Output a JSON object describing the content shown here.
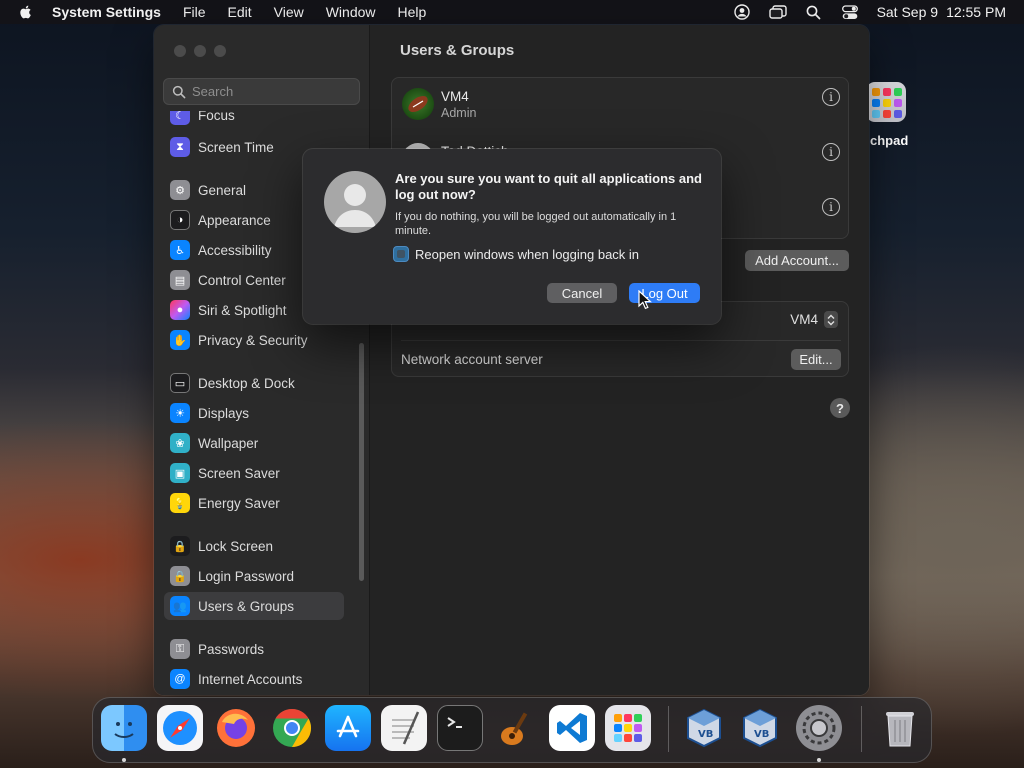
{
  "menubar": {
    "app_name": "System Settings",
    "items": [
      "File",
      "Edit",
      "View",
      "Window",
      "Help"
    ],
    "date": "Sat Sep 9",
    "time": "12:55 PM",
    "status_icons": [
      "user-icon",
      "window-icon",
      "search-icon",
      "control-center-icon"
    ]
  },
  "desktop": {
    "icon_label": "chpad"
  },
  "sidebar": {
    "search_placeholder": "Search",
    "items": [
      {
        "label": "Focus",
        "icon": "moon-icon",
        "color": "#5e5ce6"
      },
      {
        "label": "Screen Time",
        "icon": "hourglass-icon",
        "color": "#5e5ce6"
      },
      {
        "label": "General",
        "icon": "gear-icon",
        "color": "#8e8e93"
      },
      {
        "label": "Appearance",
        "icon": "appearance-icon",
        "color": "#1c1c1e"
      },
      {
        "label": "Accessibility",
        "icon": "accessibility-icon",
        "color": "#0a84ff"
      },
      {
        "label": "Control Center",
        "icon": "control-center-icon",
        "color": "#8e8e93"
      },
      {
        "label": "Siri & Spotlight",
        "icon": "siri-icon",
        "color": "#bf5af2"
      },
      {
        "label": "Privacy & Security",
        "icon": "hand-icon",
        "color": "#0a84ff"
      },
      {
        "label": "Desktop & Dock",
        "icon": "dock-icon",
        "color": "#1c1c1e"
      },
      {
        "label": "Displays",
        "icon": "displays-icon",
        "color": "#0a84ff"
      },
      {
        "label": "Wallpaper",
        "icon": "wallpaper-icon",
        "color": "#30b0c7"
      },
      {
        "label": "Screen Saver",
        "icon": "screen-saver-icon",
        "color": "#30b0c7"
      },
      {
        "label": "Energy Saver",
        "icon": "battery-icon",
        "color": "#ffd60a"
      },
      {
        "label": "Lock Screen",
        "icon": "lock-icon",
        "color": "#1c1c1e"
      },
      {
        "label": "Login Password",
        "icon": "lock-icon",
        "color": "#8e8e93"
      },
      {
        "label": "Users & Groups",
        "icon": "users-icon",
        "color": "#0a84ff"
      },
      {
        "label": "Passwords",
        "icon": "key-icon",
        "color": "#8e8e93"
      },
      {
        "label": "Internet Accounts",
        "icon": "at-icon",
        "color": "#0a84ff"
      }
    ],
    "selected": "Users & Groups"
  },
  "content": {
    "title": "Users & Groups",
    "users": [
      {
        "name": "VM4",
        "role": "Admin"
      },
      {
        "name": "Ted Dattich",
        "role": ""
      },
      {
        "name": "",
        "role": ""
      }
    ],
    "add_account_label": "Add Account...",
    "auto_login_value": "VM4",
    "network_server_label": "Network account server",
    "edit_label": "Edit...",
    "help_label": "?"
  },
  "dialog": {
    "title": "Are you sure you want to quit all applications and log out now?",
    "message": "If you do nothing, you will be logged out automatically in 1 minute.",
    "checkbox_label": "Reopen windows when logging back in",
    "checkbox_checked": true,
    "cancel_label": "Cancel",
    "logout_label": "Log Out"
  },
  "dock": {
    "apps": [
      "Finder",
      "Safari",
      "Firefox",
      "Chrome",
      "App Store",
      "TextEdit",
      "Terminal",
      "GarageBand",
      "Visual Studio Code",
      "Launchpad",
      "VirtualBox",
      "VirtualBox",
      "System Settings",
      "Trash"
    ]
  },
  "colors": {
    "accent": "#2e7cf6",
    "selected_sidebar": "#3c3c3e",
    "window_bg": "#232323"
  }
}
